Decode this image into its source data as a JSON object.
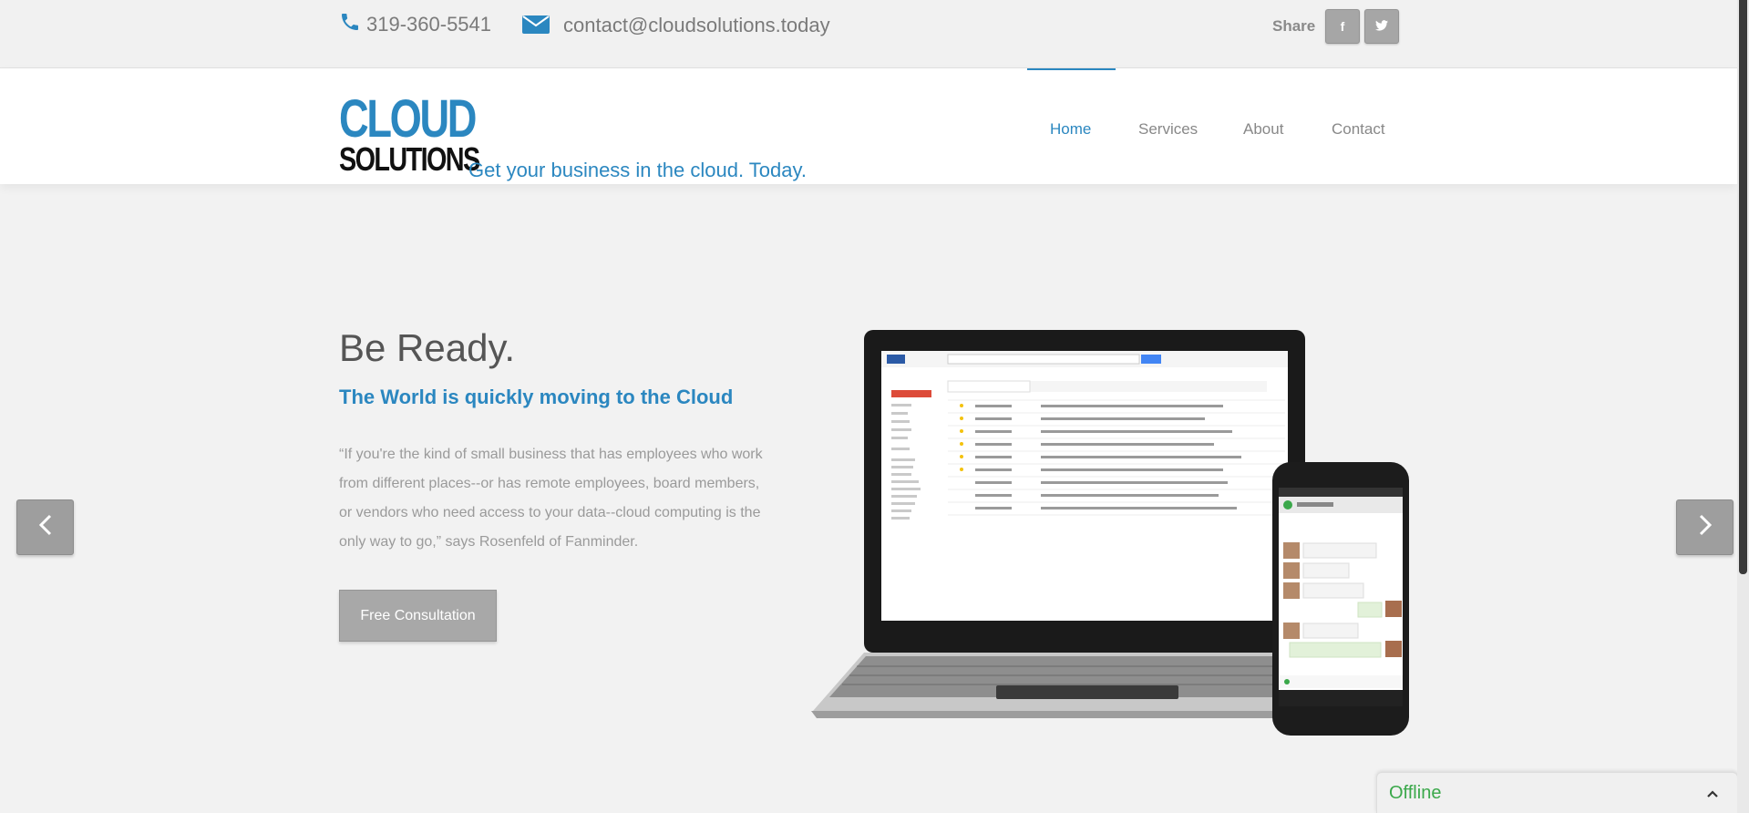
{
  "topbar": {
    "phone": "319-360-5541",
    "email": "contact@cloudsolutions.today",
    "share_label": "Share",
    "facebook_glyph": "f",
    "twitter_icon": "twitter-icon"
  },
  "header": {
    "logo_line1": "CLOUD",
    "logo_line2": "SOLUTIONS",
    "tagline": "Get your business in the cloud. Today.",
    "nav": [
      {
        "label": "Home",
        "active": true
      },
      {
        "label": "Services",
        "active": false
      },
      {
        "label": "About",
        "active": false
      },
      {
        "label": "Contact",
        "active": false
      }
    ]
  },
  "hero": {
    "title": "Be Ready.",
    "subtitle": "The World is quickly moving to the Cloud",
    "quote": "“If you're the kind of small business that has employees who work from different places--or has remote employees, board members, or vendors who need access to your data--cloud computing is the only way to go,” says Rosenfeld of Fanminder.",
    "cta_label": "Free Consultation",
    "image_alt": "laptop-and-phone-illustration"
  },
  "chat": {
    "status": "Offline"
  },
  "colors": {
    "accent": "#2b87c0",
    "button_gray": "#a8a8a8",
    "background": "#f2f2f2",
    "online_green": "#3aa84a"
  }
}
